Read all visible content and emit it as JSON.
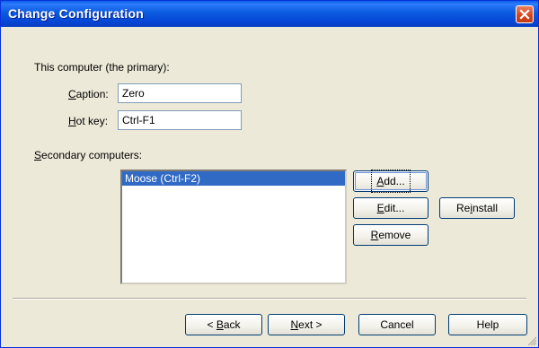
{
  "window": {
    "title": "Change Configuration",
    "close_icon": "close-icon"
  },
  "primary": {
    "section_label": "This computer (the primary):",
    "caption_label_hot": "C",
    "caption_label_rest": "aption:",
    "caption_value": "Zero",
    "hotkey_label_hot": "H",
    "hotkey_label_rest": "ot key:",
    "hotkey_value": "Ctrl-F1"
  },
  "secondary": {
    "section_label_hot": "S",
    "section_label_rest": "econdary computers:",
    "items": [
      {
        "label": "Moose (Ctrl-F2)",
        "selected": true
      }
    ]
  },
  "side_buttons": {
    "add_hot": "A",
    "add_rest": "dd...",
    "edit_hot": "E",
    "edit_rest": "dit...",
    "reinstall_pre": "Re",
    "reinstall_hot": "i",
    "reinstall_rest": "nstall",
    "remove_hot": "R",
    "remove_rest": "emove"
  },
  "footer_buttons": {
    "back_pre": "< ",
    "back_hot": "B",
    "back_rest": "ack",
    "next_hot": "N",
    "next_rest": "ext >",
    "cancel": "Cancel",
    "help": "Help"
  },
  "colors": {
    "titlebar": "#0A5FEA",
    "dialog_bg": "#ECE9D8",
    "selection": "#316AC5",
    "close_button": "#D4471F"
  }
}
